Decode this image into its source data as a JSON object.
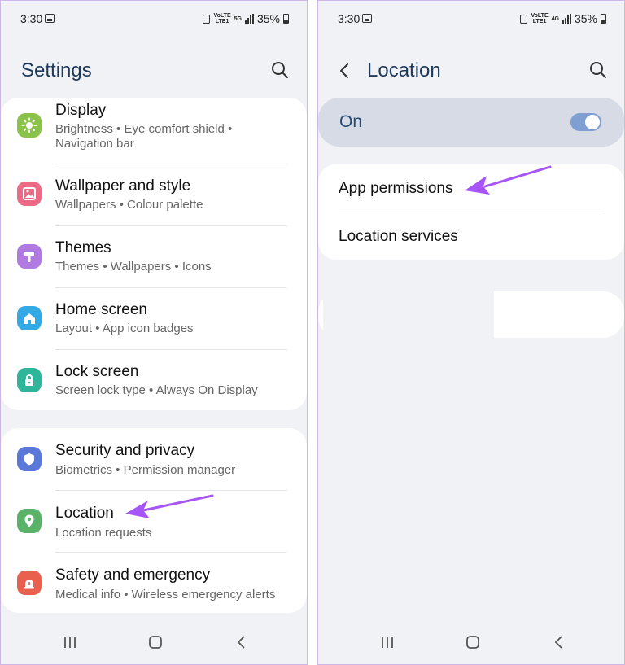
{
  "left": {
    "status": {
      "time": "3:30",
      "network_top": "VoLTE",
      "network_bottom": "LTE1",
      "network_gen": "5G",
      "battery": "35%"
    },
    "header": {
      "title": "Settings"
    },
    "group1": [
      {
        "title": "Display",
        "subtitle": "Brightness  •  Eye comfort shield  •  Navigation bar",
        "icon": "display-icon",
        "color": "#8bc34a"
      },
      {
        "title": "Wallpaper and style",
        "subtitle": "Wallpapers  •  Colour palette",
        "icon": "wallpaper-icon",
        "color": "#ec6a85"
      },
      {
        "title": "Themes",
        "subtitle": "Themes  •  Wallpapers  •  Icons",
        "icon": "themes-icon",
        "color": "#b07ae0"
      },
      {
        "title": "Home screen",
        "subtitle": "Layout  •  App icon badges",
        "icon": "home-icon",
        "color": "#33a9e6"
      },
      {
        "title": "Lock screen",
        "subtitle": "Screen lock type  •  Always On Display",
        "icon": "lock-icon",
        "color": "#2fb59a"
      }
    ],
    "group2": [
      {
        "title": "Security and privacy",
        "subtitle": "Biometrics  •  Permission manager",
        "icon": "shield-icon",
        "color": "#5a78d8"
      },
      {
        "title": "Location",
        "subtitle": "Location requests",
        "icon": "location-pin-icon",
        "color": "#59b46a"
      },
      {
        "title": "Safety and emergency",
        "subtitle": "Medical info  •  Wireless emergency alerts",
        "icon": "emergency-icon",
        "color": "#e9604f"
      }
    ]
  },
  "right": {
    "status": {
      "time": "3:30",
      "network_top": "VoLTE",
      "network_bottom": "LTE1",
      "network_gen": "4G",
      "battery": "35%"
    },
    "header": {
      "title": "Location"
    },
    "toggle": {
      "label": "On",
      "state": "on"
    },
    "items": [
      {
        "label": "App permissions"
      },
      {
        "label": "Location services"
      }
    ]
  },
  "colors": {
    "arrow": "#a855f7",
    "title": "#1d3a5c",
    "toggle_track": "#7f9fd2",
    "toggle_card": "#d6dbe5"
  }
}
